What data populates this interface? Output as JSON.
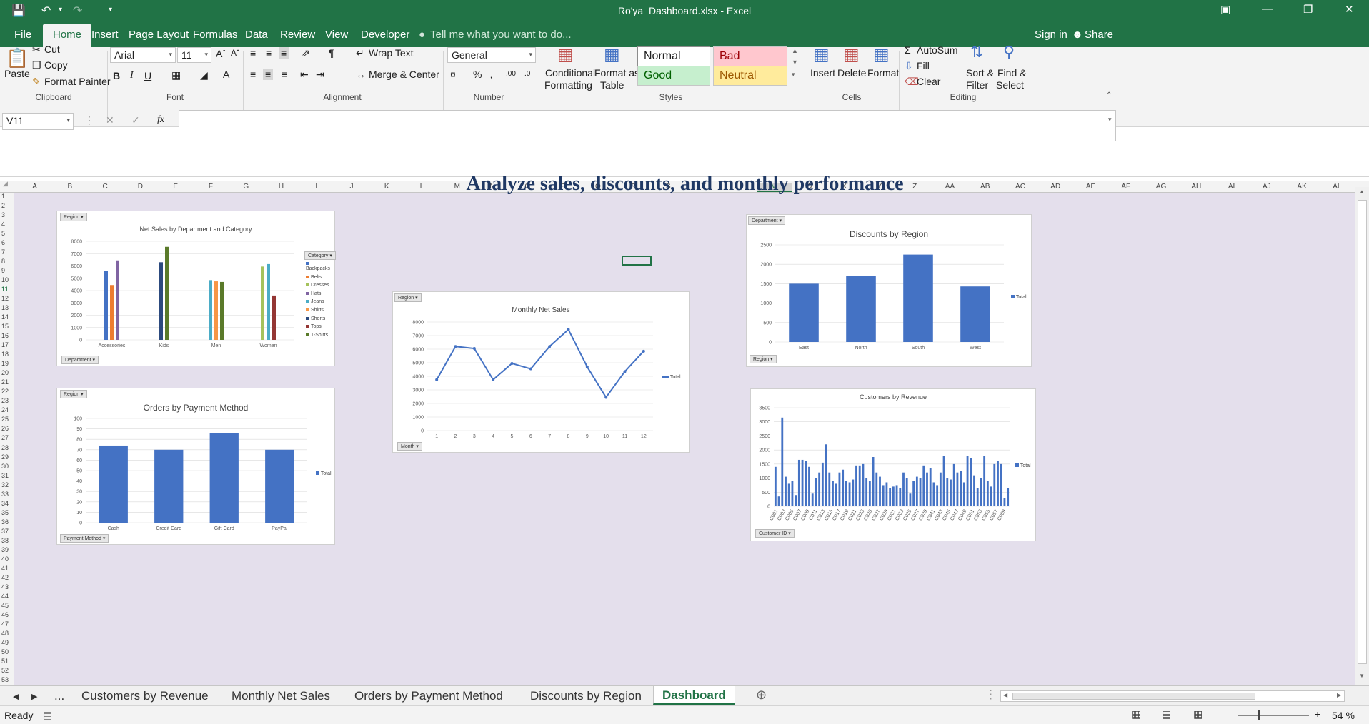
{
  "window": {
    "title": "Ro'ya_Dashboard.xlsx - Excel"
  },
  "ribbon_tabs": [
    "File",
    "Home",
    "Insert",
    "Page Layout",
    "Formulas",
    "Data",
    "Review",
    "View",
    "Developer"
  ],
  "tell_me": "Tell me what you want to do...",
  "account": {
    "sign_in": "Sign in",
    "share": "Share"
  },
  "clipboard": {
    "paste": "Paste",
    "cut": "Cut",
    "copy": "Copy",
    "format_painter": "Format Painter",
    "label": "Clipboard"
  },
  "font": {
    "name": "Arial",
    "size": "11",
    "label": "Font"
  },
  "alignment": {
    "wrap": "Wrap Text",
    "merge": "Merge & Center",
    "label": "Alignment"
  },
  "number": {
    "format": "General",
    "label": "Number"
  },
  "styles": {
    "cf_line1": "Conditional",
    "cf_line2": "Formatting",
    "fat_line1": "Format as",
    "fat_line2": "Table",
    "normal": "Normal",
    "bad": "Bad",
    "good": "Good",
    "neutral": "Neutral",
    "label": "Styles"
  },
  "cells": {
    "insert": "Insert",
    "delete": "Delete",
    "format": "Format",
    "label": "Cells"
  },
  "editing": {
    "autosum": "AutoSum",
    "fill": "Fill",
    "clear": "Clear",
    "sort_line1": "Sort &",
    "sort_line2": "Filter",
    "find_line1": "Find &",
    "find_line2": "Select",
    "label": "Editing"
  },
  "name_box": "V11",
  "fx": "fx",
  "columns": [
    "A",
    "B",
    "C",
    "D",
    "E",
    "F",
    "G",
    "H",
    "I",
    "J",
    "K",
    "L",
    "M",
    "N",
    "O",
    "P",
    "Q",
    "R",
    "S",
    "T",
    "U",
    "V",
    "W",
    "X",
    "Y",
    "Z",
    "AA",
    "AB",
    "AC",
    "AD",
    "AE",
    "AF",
    "AG",
    "AH",
    "AI",
    "AJ",
    "AK",
    "AL"
  ],
  "rows": [
    "1",
    "2",
    "3",
    "4",
    "5",
    "6",
    "7",
    "8",
    "9",
    "10",
    "11",
    "12",
    "13",
    "14",
    "15",
    "16",
    "17",
    "18",
    "19",
    "20",
    "21",
    "22",
    "23",
    "24",
    "25",
    "26",
    "27",
    "28",
    "29",
    "30",
    "31",
    "32",
    "33",
    "34",
    "35",
    "36",
    "37",
    "38",
    "39",
    "40",
    "41",
    "42",
    "43",
    "44",
    "45",
    "46",
    "47",
    "48",
    "49",
    "50",
    "51",
    "52",
    "53"
  ],
  "dashboard_title": "Analyze sales, discounts, and monthly performance",
  "chart_data": [
    {
      "type": "bar",
      "title": "Net Sales by Department and Category",
      "filter_top": "Region",
      "filter_bottom": "Department",
      "legend_title": "Category",
      "categories": [
        "Accessories",
        "Kids",
        "Men",
        "Women"
      ],
      "series": [
        {
          "name": "Backpacks",
          "color": "#4472c4",
          "values": [
            5600,
            null,
            null,
            null
          ]
        },
        {
          "name": "Belts",
          "color": "#ed7d31",
          "values": [
            4450,
            null,
            null,
            null
          ]
        },
        {
          "name": "Dresses",
          "color": "#a5c25c",
          "values": [
            null,
            null,
            null,
            5950
          ]
        },
        {
          "name": "Hats",
          "color": "#8064a2",
          "values": [
            6450,
            null,
            null,
            null
          ]
        },
        {
          "name": "Jeans",
          "color": "#4bacc6",
          "values": [
            null,
            null,
            4850,
            6150
          ]
        },
        {
          "name": "Shirts",
          "color": "#f79646",
          "values": [
            null,
            null,
            4750,
            null
          ]
        },
        {
          "name": "Shorts",
          "color": "#2c4a7e",
          "values": [
            null,
            6300,
            null,
            null
          ]
        },
        {
          "name": "Tops",
          "color": "#943634",
          "values": [
            null,
            null,
            null,
            3600
          ]
        },
        {
          "name": "T-Shirts",
          "color": "#5a7a2a",
          "values": [
            null,
            7550,
            4700,
            null
          ]
        }
      ],
      "ylim": [
        0,
        8000
      ],
      "yticks": [
        0,
        1000,
        2000,
        3000,
        4000,
        5000,
        6000,
        7000,
        8000
      ]
    },
    {
      "type": "line",
      "title": "Monthly Net Sales",
      "filter_top": "Region",
      "filter_bottom": "Month",
      "legend": "Total",
      "categories": [
        "1",
        "2",
        "3",
        "4",
        "5",
        "6",
        "7",
        "8",
        "9",
        "10",
        "11",
        "12"
      ],
      "values": [
        3750,
        6200,
        6050,
        3750,
        4950,
        4550,
        6200,
        7450,
        4700,
        2450,
        4350,
        5850
      ],
      "ylim": [
        0,
        8000
      ],
      "yticks": [
        0,
        1000,
        2000,
        3000,
        4000,
        5000,
        6000,
        7000,
        8000
      ]
    },
    {
      "type": "bar",
      "title": "Discounts by Region",
      "filter_top": "Department",
      "filter_bottom": "Region",
      "legend": "Total",
      "categories": [
        "East",
        "North",
        "South",
        "West"
      ],
      "values": [
        1500,
        1700,
        2250,
        1430
      ],
      "ylim": [
        0,
        2500
      ],
      "yticks": [
        0,
        500,
        1000,
        1500,
        2000,
        2500
      ]
    },
    {
      "type": "bar",
      "title": "Orders by Payment Method",
      "filter_top": "Region",
      "filter_bottom": "Payment Method",
      "legend": "Total",
      "categories": [
        "Cash",
        "Credit Card",
        "Gift Card",
        "PayPal"
      ],
      "values": [
        74,
        70,
        86,
        70
      ],
      "ylim": [
        0,
        100
      ],
      "yticks": [
        0,
        10,
        20,
        30,
        40,
        50,
        60,
        70,
        80,
        90,
        100
      ]
    },
    {
      "type": "bar",
      "title": "Customers by Revenue",
      "filter_bottom": "Customer ID",
      "legend": "Total",
      "categories": [
        "C001",
        "C003",
        "C005",
        "C007",
        "C009",
        "C011",
        "C013",
        "C015",
        "C017",
        "C019",
        "C021",
        "C023",
        "C025",
        "C027",
        "C029",
        "C031",
        "C033",
        "C035",
        "C037",
        "C039",
        "C041",
        "C043",
        "C045",
        "C047",
        "C049",
        "C051",
        "C053",
        "C055",
        "C057",
        "C059"
      ],
      "values": [
        1400,
        350,
        3150,
        1050,
        800,
        900,
        400,
        1650,
        1650,
        1600,
        1400,
        450,
        1000,
        1200,
        1550,
        2200,
        1200,
        900,
        800,
        1200,
        1300,
        900,
        850,
        950,
        1450,
        1450,
        1500,
        1000,
        900,
        1750,
        1200,
        1050,
        750,
        850,
        650,
        700,
        750,
        650,
        1200,
        1000,
        450,
        900,
        1050,
        1000,
        1450,
        1200,
        1350,
        850,
        750,
        1200,
        1800,
        1000,
        950,
        1500,
        1200,
        1250,
        850,
        1800,
        1700,
        1100,
        650,
        1000,
        1800,
        900,
        700,
        1500,
        1600,
        1500,
        300,
        650
      ],
      "ylim": [
        0,
        3500
      ],
      "yticks": [
        0,
        500,
        1000,
        1500,
        2000,
        2500,
        3000,
        3500
      ]
    }
  ],
  "sheet_tabs": [
    "Customers by Revenue",
    "Monthly Net Sales",
    "Orders by Payment Method",
    "Discounts by Region",
    "Dashboard"
  ],
  "status": {
    "ready": "Ready",
    "zoom": "54 %"
  }
}
